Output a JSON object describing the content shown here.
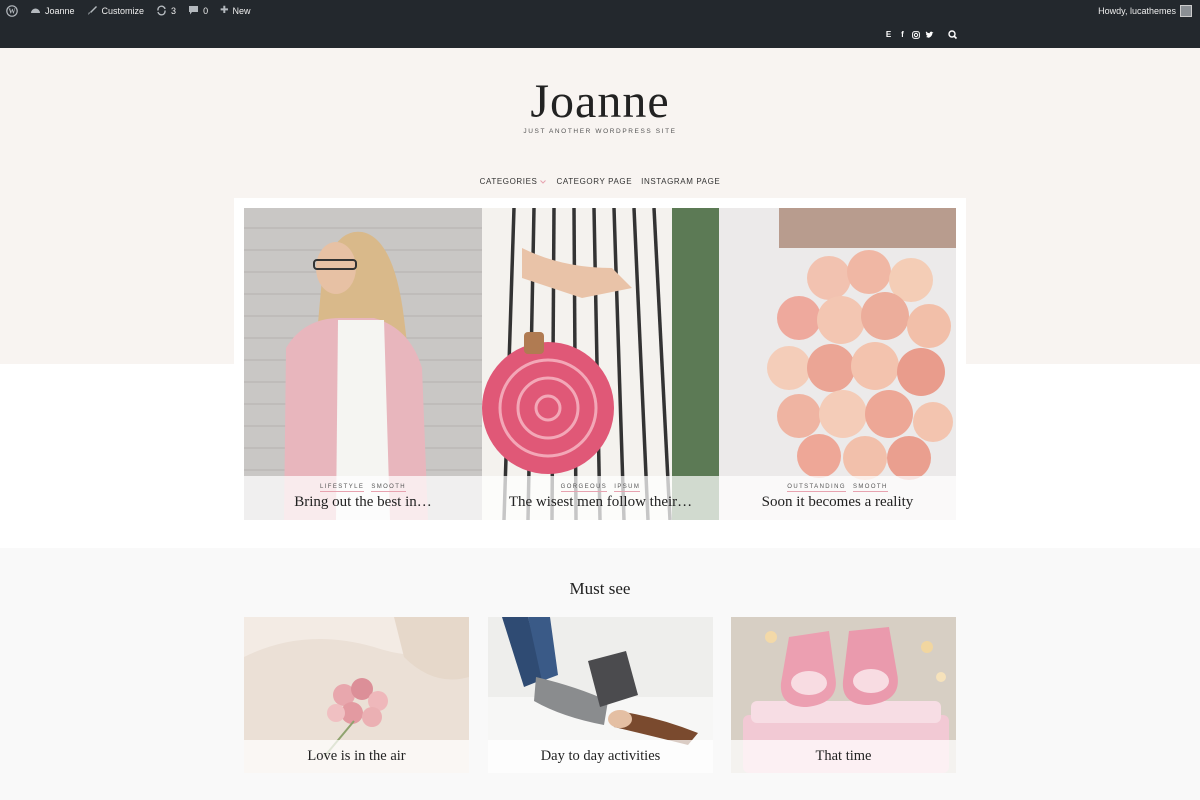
{
  "admin_bar": {
    "site_name": "Joanne",
    "customize": "Customize",
    "updates_count": "3",
    "comments_count": "0",
    "new_label": "New",
    "greeting": "Howdy, lucathemes"
  },
  "social": {
    "icons": [
      "E",
      "f",
      "instagram-icon",
      "twitter-icon"
    ],
    "e_label": "E",
    "f_label": "f"
  },
  "header": {
    "site_title": "Joanne",
    "tagline": "JUST ANOTHER WORDPRESS SITE"
  },
  "nav": {
    "items": [
      {
        "label": "CATEGORIES"
      },
      {
        "label": "CATEGORY PAGE"
      },
      {
        "label": "INSTAGRAM PAGE"
      }
    ]
  },
  "slider": {
    "slides": [
      {
        "categories": [
          "LIFESTYLE",
          "SMOOTH"
        ],
        "title": "Bring out the best in…"
      },
      {
        "categories": [
          "GORGEOUS",
          "IPSUM"
        ],
        "title": "The wisest men follow their…"
      },
      {
        "categories": [
          "OUTSTANDING",
          "SMOOTH"
        ],
        "title": "Soon it becomes a reality"
      }
    ]
  },
  "must_see": {
    "heading": "Must see",
    "cards": [
      {
        "title": "Love is in the air"
      },
      {
        "title": "Day to day activities"
      },
      {
        "title": "That time"
      }
    ]
  },
  "colors": {
    "admin_bar_bg": "#23282d",
    "header_bg": "#f8f4f1",
    "accent_underline": "#e7a3b0",
    "must_see_bg": "#f9f9f9"
  }
}
